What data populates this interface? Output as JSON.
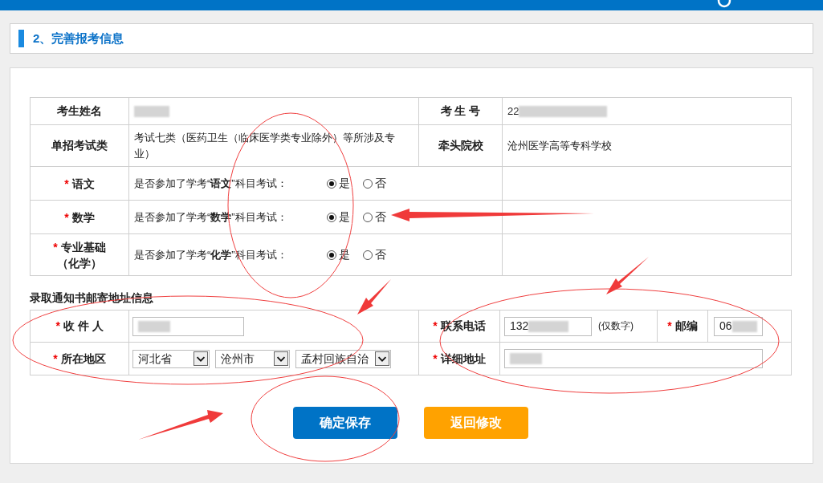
{
  "section_title": "2、完善报考信息",
  "candidate": {
    "name_label": "考生姓名",
    "number_label": "考 生 号",
    "number_value": "22",
    "category_label": "单招考试类",
    "category_value": "考试七类（医药卫生（临床医学类专业除外）等所涉及专业）",
    "school_label": "牵头院校",
    "school_value": "沧州医学高等专科学校"
  },
  "subjects": [
    {
      "mark": "*",
      "label": "语文",
      "question": "是否参加了学考“**语文**”科目考试：",
      "options": [
        {
          "label": "是",
          "selected": true
        },
        {
          "label": "否",
          "selected": false
        }
      ]
    },
    {
      "mark": "*",
      "label": "数学",
      "question": "是否参加了学考“**数学**”科目考试：",
      "options": [
        {
          "label": "是",
          "selected": true
        },
        {
          "label": "否",
          "selected": false
        }
      ]
    },
    {
      "mark": "*",
      "label": "专业基础（化学）",
      "question": "是否参加了学考“**化学**”科目考试：",
      "options": [
        {
          "label": "是",
          "selected": true
        },
        {
          "label": "否",
          "selected": false
        }
      ]
    }
  ],
  "address": {
    "title": "录取通知书邮寄地址信息",
    "recipient_mark": "*",
    "recipient_label": "收 件 人",
    "phone_mark": "*",
    "phone_label": "联系电话",
    "phone_value": "132",
    "phone_hint": "(仅数字)",
    "postcode_mark": "*",
    "postcode_label": "邮编",
    "postcode_value": "06",
    "region_mark": "*",
    "region_label": "所在地区",
    "selects": [
      "河北省",
      "沧州市",
      "孟村回族自治"
    ],
    "detail_mark": "*",
    "detail_label": "详细地址"
  },
  "buttons": [
    {
      "label": "确定保存",
      "kind": "primary"
    },
    {
      "label": "返回修改",
      "kind": "secondary"
    }
  ]
}
